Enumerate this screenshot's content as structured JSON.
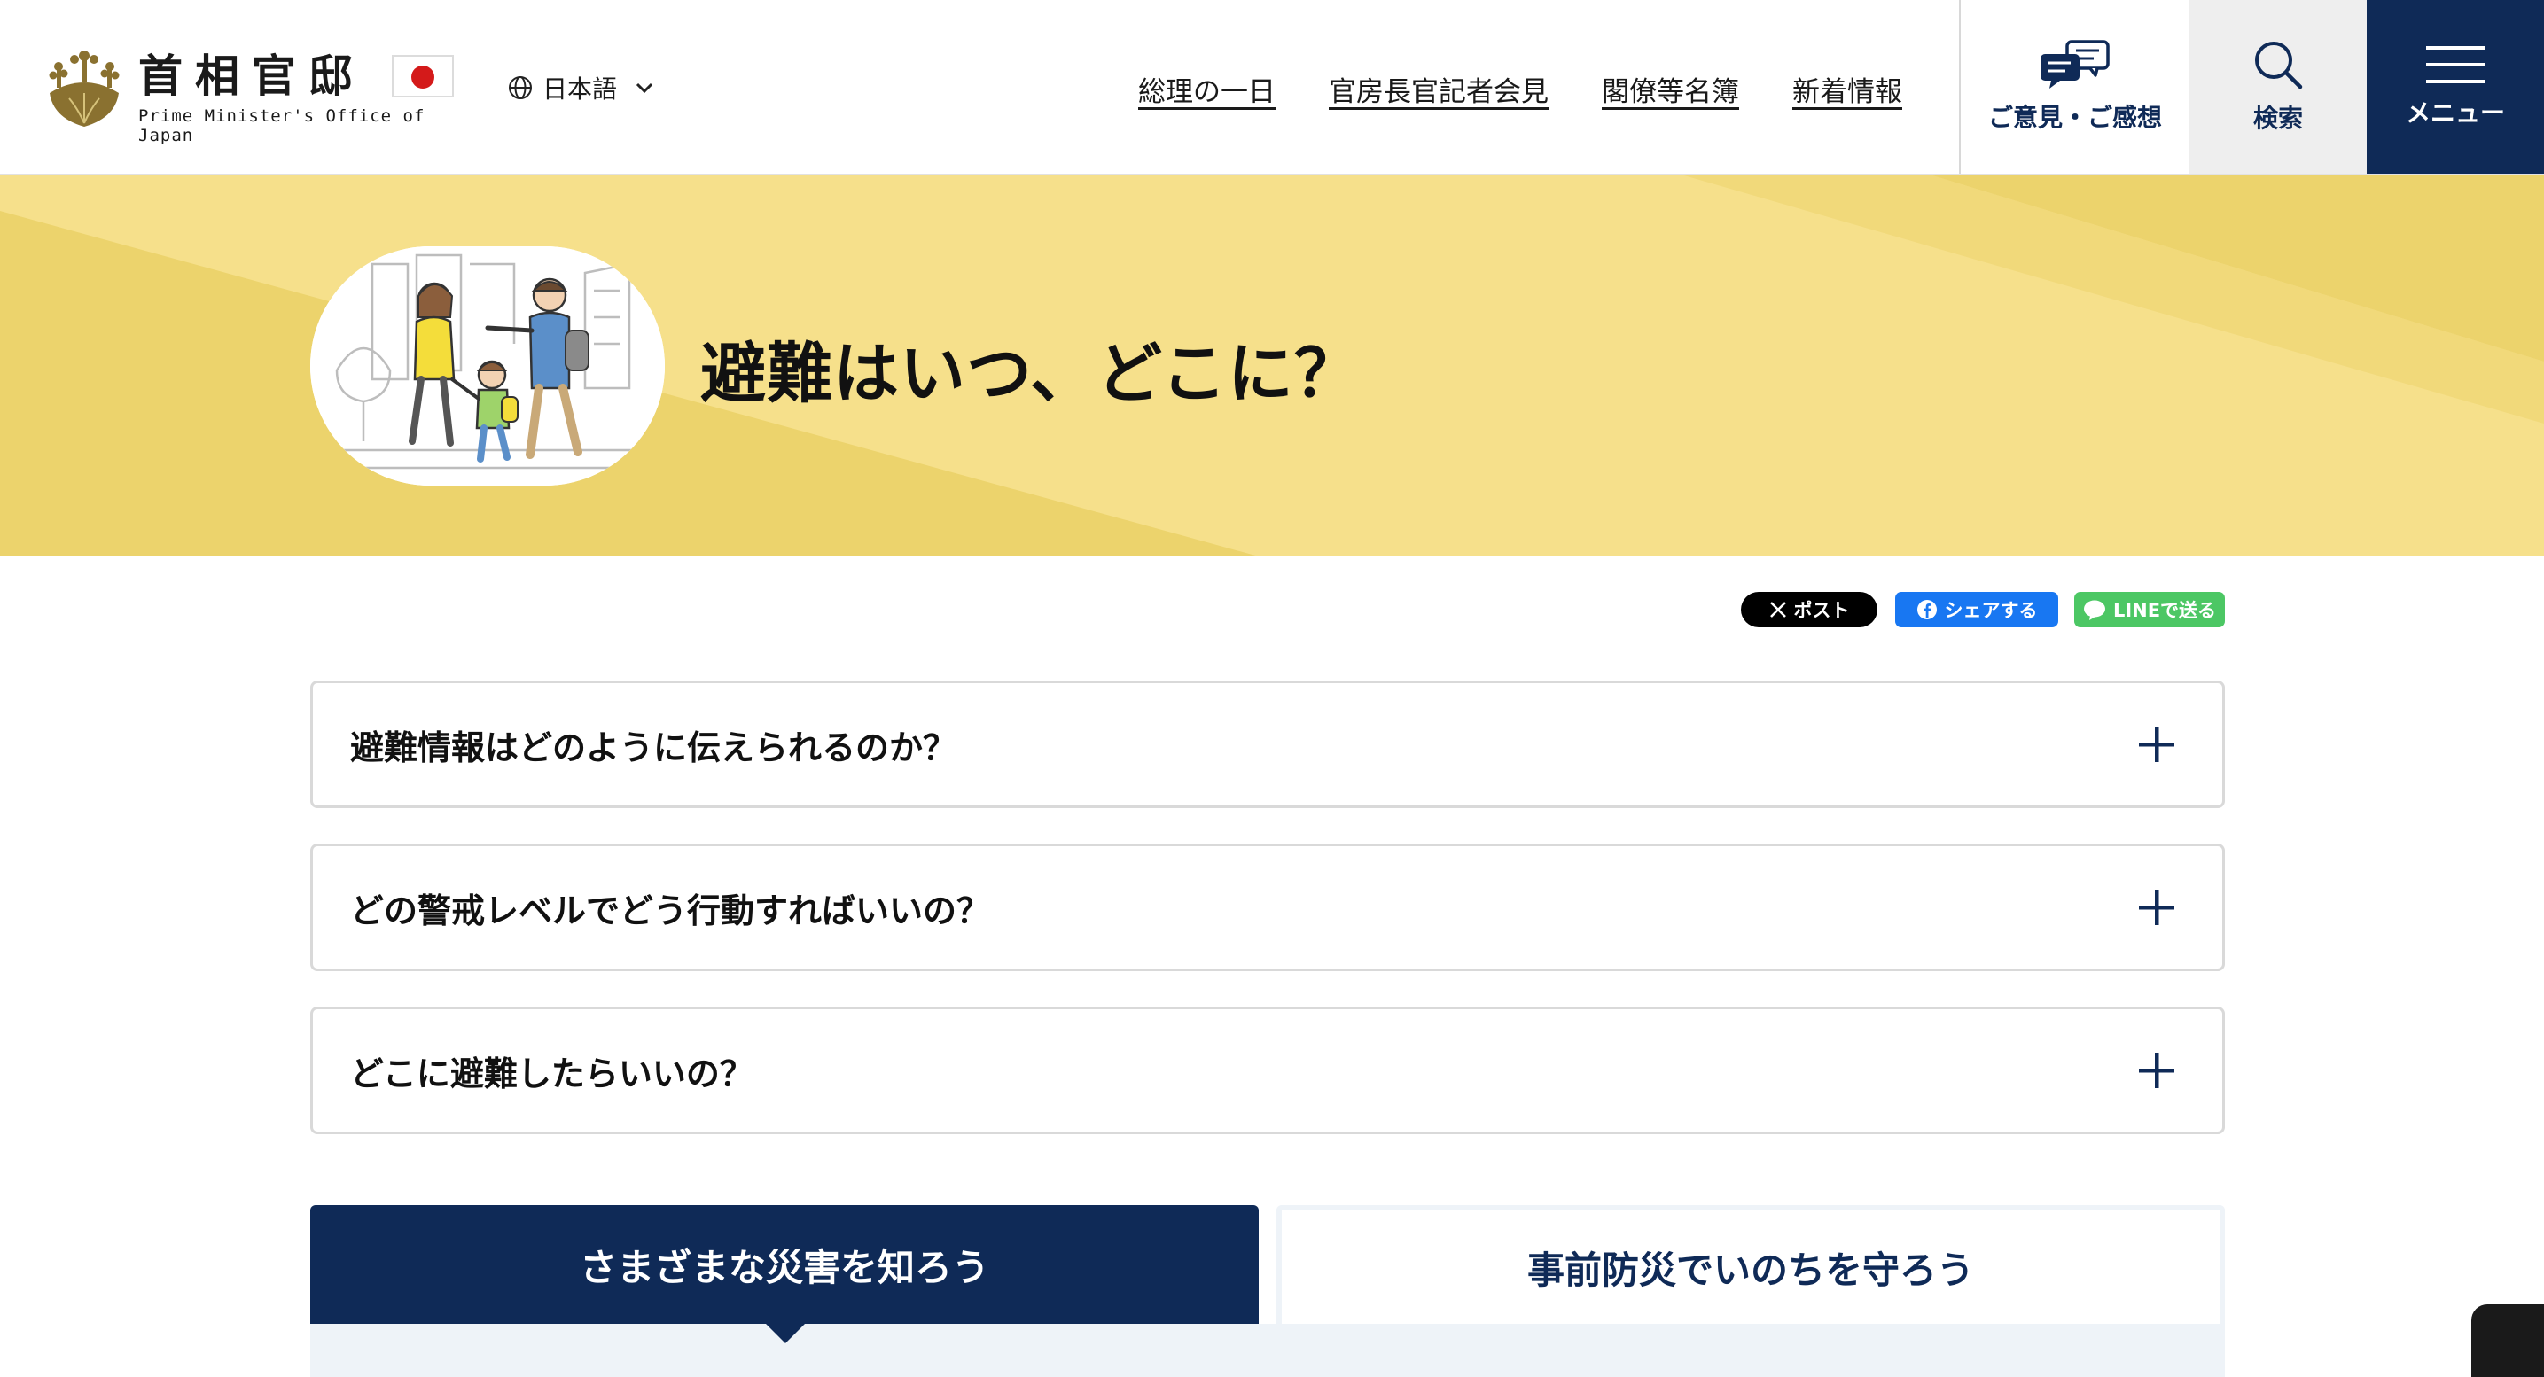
{
  "header": {
    "logo": {
      "title_ja": "首相官邸",
      "subtitle_en": "Prime Minister's Office of Japan"
    },
    "language": {
      "label": "日本語"
    },
    "nav": [
      {
        "label": "総理の一日"
      },
      {
        "label": "官房長官記者会見"
      },
      {
        "label": "閣僚等名簿"
      },
      {
        "label": "新着情報"
      }
    ],
    "buttons": {
      "opinion": "ご意見・ご感想",
      "search": "検索",
      "menu": "メニュー"
    }
  },
  "hero": {
    "title": "避難はいつ、どこに？"
  },
  "share": {
    "x": "ポスト",
    "facebook": "シェアする",
    "line": "LINEで送る"
  },
  "accordion": [
    {
      "label": "避難情報はどのように伝えられるのか？"
    },
    {
      "label": "どの警戒レベルでどう行動すればいいの？"
    },
    {
      "label": "どこに避難したらいいの？"
    }
  ],
  "tabs": [
    {
      "label": "さまざまな災害を知ろう",
      "active": true
    },
    {
      "label": "事前防災でいのちを守ろう",
      "active": false
    }
  ],
  "colors": {
    "navy": "#0f2a57",
    "hero_yellow": "#f6e08b",
    "hero_yellow_dark": "#ecd36c",
    "share_facebook": "#1877f2",
    "share_line": "#4cc764"
  },
  "icons": {
    "logo": "paulownia-crest-icon",
    "flag": "japan-flag-icon",
    "language": "globe-icon",
    "language_toggle": "chevron-down-icon",
    "opinion": "chat-bubbles-icon",
    "search": "search-icon",
    "menu": "hamburger-icon",
    "accordion": "plus-icon"
  }
}
